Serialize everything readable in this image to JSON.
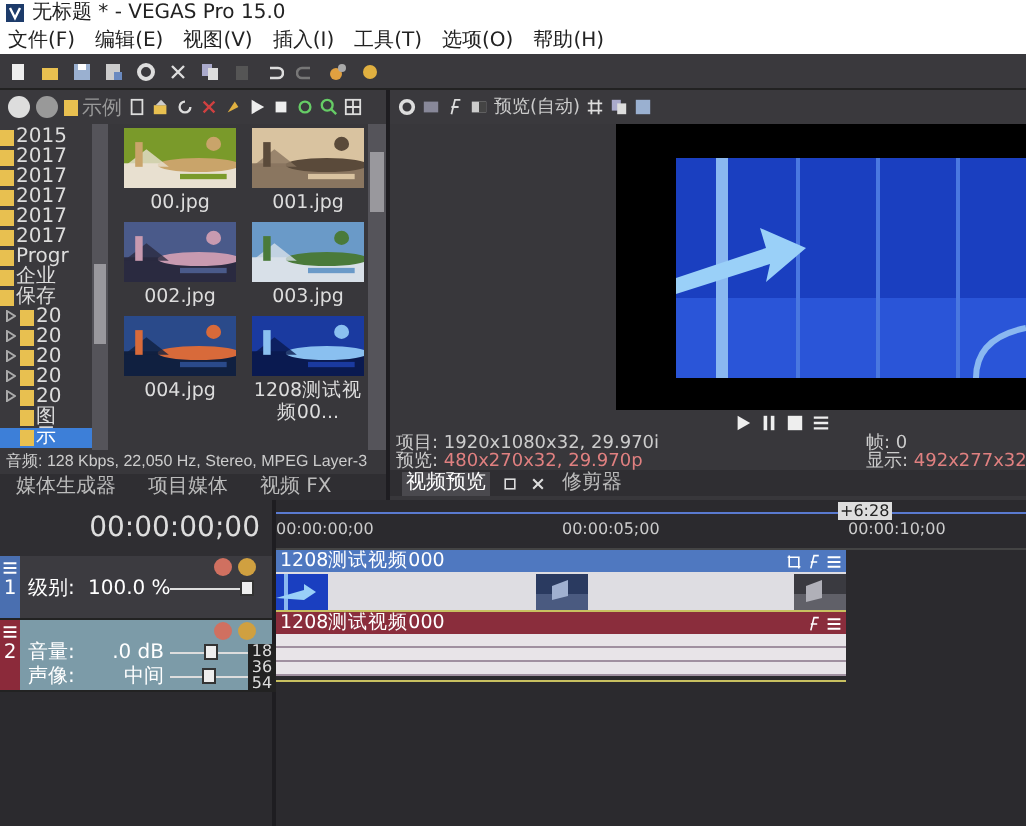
{
  "window": {
    "title": "无标题 * - VEGAS Pro 15.0"
  },
  "menu": [
    "文件(F)",
    "编辑(E)",
    "视图(V)",
    "插入(I)",
    "工具(T)",
    "选项(O)",
    "帮助(H)"
  ],
  "explorer": {
    "path": "示例",
    "folders": [
      {
        "label": "2015",
        "selected": false
      },
      {
        "label": "2017",
        "selected": false
      },
      {
        "label": "2017",
        "selected": false
      },
      {
        "label": "2017",
        "selected": false
      },
      {
        "label": "2017",
        "selected": false
      },
      {
        "label": "2017",
        "selected": false
      },
      {
        "label": "Progr",
        "selected": false
      },
      {
        "label": "企业",
        "selected": false
      },
      {
        "label": "保存",
        "selected": false,
        "children": [
          {
            "label": "20",
            "collapsed": true,
            "selected": false
          },
          {
            "label": "20",
            "collapsed": true,
            "selected": false
          },
          {
            "label": "20",
            "collapsed": true,
            "selected": false
          },
          {
            "label": "20",
            "collapsed": true,
            "selected": false
          },
          {
            "label": "20",
            "collapsed": true,
            "selected": false
          },
          {
            "label": "图",
            "collapsed": false,
            "selected": false
          },
          {
            "label": "示",
            "collapsed": false,
            "selected": true
          }
        ]
      }
    ],
    "files": [
      {
        "name": "00.jpg",
        "kind": "picture"
      },
      {
        "name": "001.jpg",
        "kind": "picture"
      },
      {
        "name": "002.jpg",
        "kind": "picture"
      },
      {
        "name": "003.jpg",
        "kind": "picture"
      },
      {
        "name": "004.jpg",
        "kind": "picture"
      },
      {
        "name": "1208测试视频00...",
        "kind": "picture"
      }
    ],
    "status": "音频: 128 Kbps, 22,050 Hz, Stereo, MPEG Layer-3",
    "tabs": [
      {
        "label": "媒体生成器",
        "selected": false
      },
      {
        "label": "项目媒体",
        "selected": false
      },
      {
        "label": "视频 FX",
        "selected": false
      }
    ]
  },
  "preview": {
    "mode": "预览(自动)",
    "project": "项目: 1920x1080x32, 29.970i",
    "preview_label": "预览:",
    "preview_value": "480x270x32, 29.970p",
    "frame_label": "帧:",
    "frame_value": "0",
    "display_label": "显示:",
    "display_value": "492x277x32",
    "tabs": [
      {
        "label": "视频预览",
        "selected": true
      },
      {
        "label": "修剪器",
        "selected": false
      }
    ]
  },
  "timeline": {
    "time": "00:00:00;00",
    "marker": "+6:28",
    "ruler": [
      "00:00:00;00",
      "00:00:05;00",
      "00:00:10;00"
    ],
    "tracks": [
      {
        "kind": "video",
        "number": "1",
        "params": [
          {
            "label": "级别:",
            "value": "100.0 %",
            "level": 1.0
          }
        ],
        "clip": "1208测试视频000"
      },
      {
        "kind": "audio",
        "number": "2",
        "params": [
          {
            "label": "音量:",
            "value": ".0 dB",
            "level": 0.55
          },
          {
            "label": "声像:",
            "value": "中间",
            "level": 0.5
          }
        ],
        "meter": [
          "18",
          "36",
          "54"
        ],
        "clip": "1208测试视频000"
      }
    ]
  }
}
